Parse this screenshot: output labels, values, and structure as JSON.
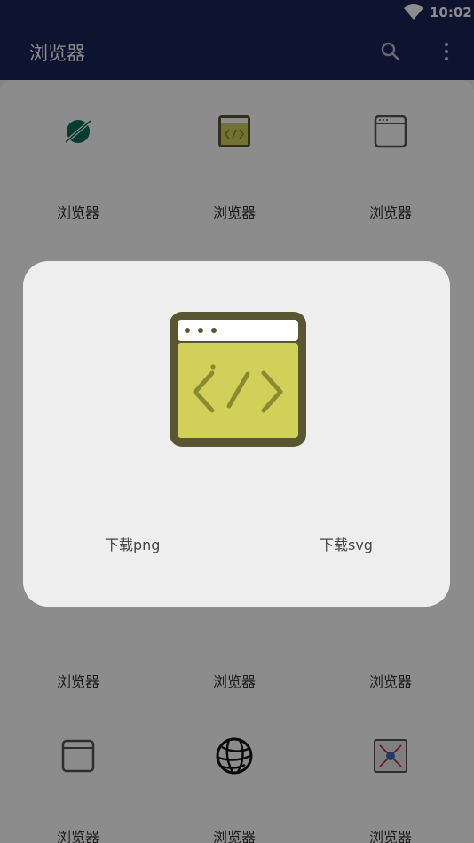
{
  "status_bar": {
    "time": "10:02"
  },
  "app_bar": {
    "title": "浏览器"
  },
  "grid": {
    "items": [
      {
        "label": "浏览器",
        "icon": "planet-icon"
      },
      {
        "label": "浏览器",
        "icon": "code-window-icon"
      },
      {
        "label": "浏览器",
        "icon": "window-outline-icon"
      },
      {
        "label": "浏览器",
        "icon": "yin-yang-icon"
      },
      {
        "label": "浏览器",
        "icon": "yellow-browser-icon"
      },
      {
        "label": "浏览器",
        "icon": "blue-globe-icon"
      },
      {
        "label": "浏览器",
        "icon": "window-outline-icon"
      },
      {
        "label": "浏览器",
        "icon": "wire-globe-icon"
      },
      {
        "label": "浏览器",
        "icon": "photo-frame-icon"
      }
    ]
  },
  "dialog": {
    "download_png": "下载png",
    "download_svg": "下载svg"
  },
  "colors": {
    "app_bar": "#1a2456",
    "dialog_bg": "#eeeeee",
    "icon_green": "#0d6e5a",
    "icon_yellow": "#d1d15a",
    "icon_dark_olive": "#5a5632"
  }
}
